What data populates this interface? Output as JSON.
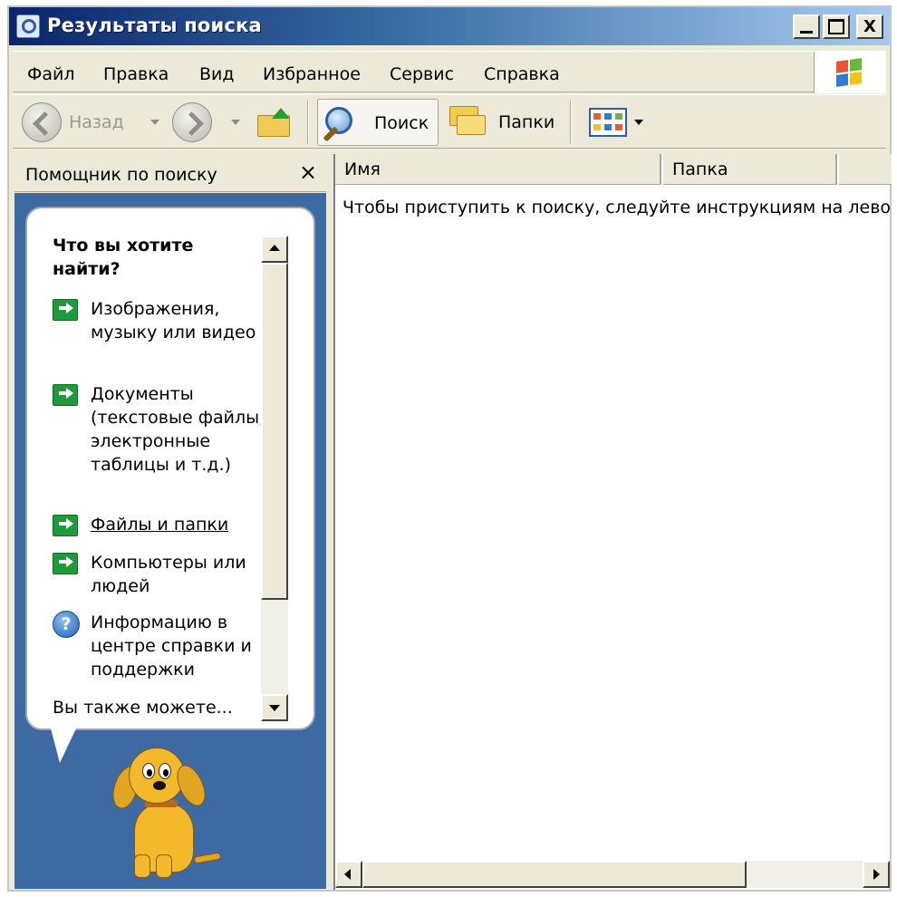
{
  "window": {
    "title": "Результаты поиска",
    "icon": "search-window-icon",
    "controls": [
      "minimize-icon",
      "maximize-icon",
      "close-icon"
    ],
    "close_glyph": "X"
  },
  "menu": {
    "items": [
      {
        "label": "Файл"
      },
      {
        "label": "Правка"
      },
      {
        "label": "Вид"
      },
      {
        "label": "Избранное"
      },
      {
        "label": "Сервис"
      },
      {
        "label": "Справка"
      }
    ],
    "logo": "windows-logo-icon"
  },
  "toolbar": {
    "back_label": "Назад",
    "search_label": "Поиск",
    "folders_label": "Папки",
    "icons": [
      "back-arrow-icon",
      "forward-arrow-icon",
      "up-folder-icon",
      "search-icon",
      "folders-icon",
      "views-icon"
    ]
  },
  "search_pane": {
    "title": "Помощник по поиску",
    "close_glyph": "×",
    "question": "Что вы хотите найти?",
    "options": [
      {
        "label": "Изображения, музыку или видео",
        "icon": "green-arrow-icon"
      },
      {
        "label": "Документы (текстовые файлы, электронные таблицы и т.д.)",
        "icon": "green-arrow-icon"
      },
      {
        "label": "Файлы и папки",
        "icon": "green-arrow-icon"
      },
      {
        "label": "Компьютеры или людей",
        "icon": "green-arrow-icon"
      },
      {
        "label": "Информацию в центре справки и поддержки",
        "icon": "help-icon"
      }
    ],
    "help_glyph": "?",
    "also": "Вы также можете...",
    "mascot": "search-dog-icon"
  },
  "results": {
    "columns": [
      {
        "label": "Имя"
      },
      {
        "label": "Папка"
      },
      {
        "label": ""
      }
    ],
    "hint": "Чтобы приступить к поиску, следуйте инструкциям на левой панели."
  },
  "colors": {
    "titlebar_start": "#0a246a",
    "titlebar_end": "#a6caf0",
    "pane_background": "#3e6aa3",
    "chrome": "#ece9d8"
  }
}
